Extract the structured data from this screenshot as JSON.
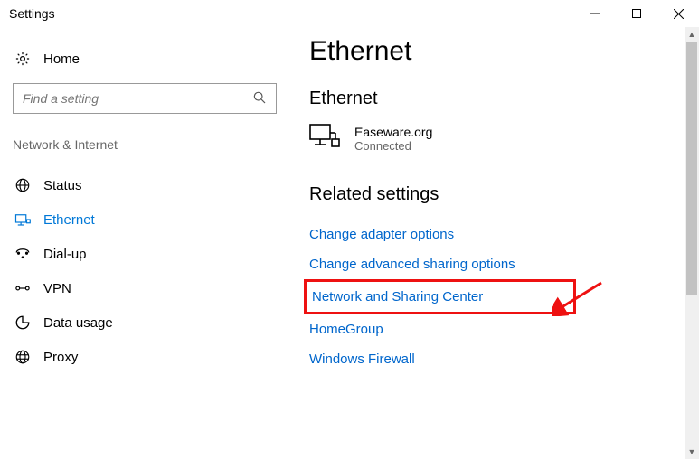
{
  "window": {
    "title": "Settings"
  },
  "sidebar": {
    "home": "Home",
    "search_placeholder": "Find a setting",
    "category": "Network & Internet",
    "items": [
      {
        "label": "Status"
      },
      {
        "label": "Ethernet"
      },
      {
        "label": "Dial-up"
      },
      {
        "label": "VPN"
      },
      {
        "label": "Data usage"
      },
      {
        "label": "Proxy"
      }
    ]
  },
  "main": {
    "title": "Ethernet",
    "conn_section": "Ethernet",
    "connection": {
      "name": "Easeware.org",
      "status": "Connected"
    },
    "related_heading": "Related settings",
    "links": {
      "adapter": "Change adapter options",
      "advanced": "Change advanced sharing options",
      "sharing": "Network and Sharing Center",
      "homegroup": "HomeGroup",
      "firewall": "Windows Firewall"
    }
  }
}
